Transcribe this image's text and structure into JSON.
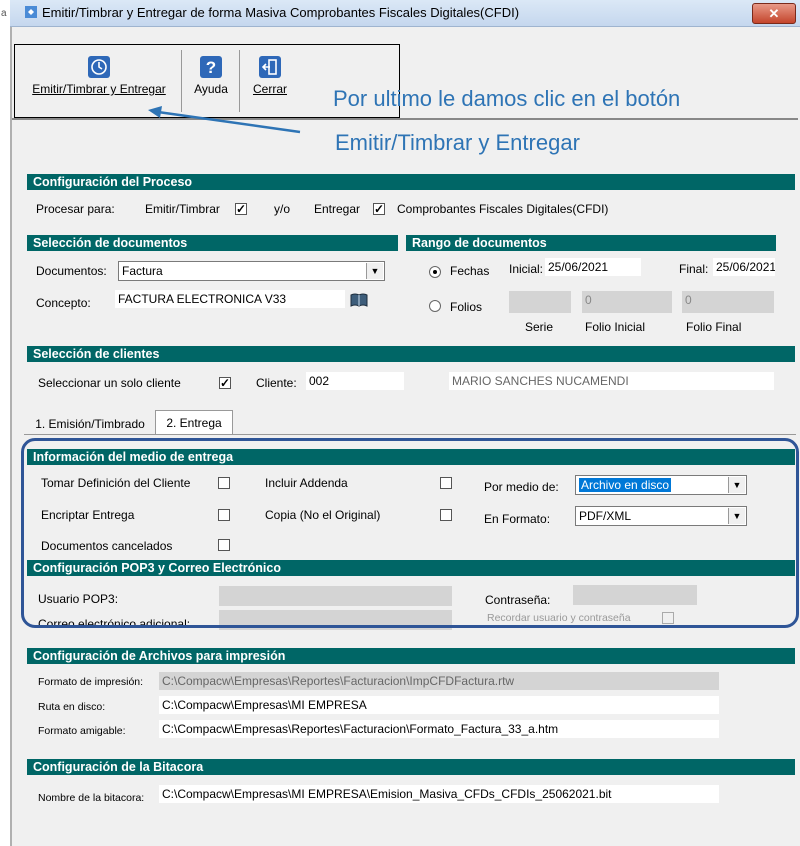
{
  "window": {
    "title": "Emitir/Timbrar y Entregar de forma Masiva Comprobantes Fiscales Digitales(CFDI)",
    "close_label": "✕",
    "side_char": "a"
  },
  "toolbar": {
    "emit_label": "Emitir/Timbrar y Entregar",
    "help_label": "Ayuda",
    "close_label": "Cerrar"
  },
  "callout": {
    "line1": "Por ultimo le damos clic en el botón",
    "line2": "Emitir/Timbrar y Entregar"
  },
  "proceso": {
    "header": "Configuración del Proceso",
    "procesar_para": "Procesar para:",
    "emitir_timbrar": "Emitir/Timbrar",
    "yo": "y/o",
    "entregar": "Entregar",
    "cfdi": "Comprobantes Fiscales Digitales(CFDI)",
    "emitir_checked": "✓",
    "entregar_checked": "✓"
  },
  "documentos": {
    "header": "Selección de documentos",
    "documentos_label": "Documentos:",
    "documentos_value": "Factura",
    "concepto_label": "Concepto:",
    "concepto_value": "FACTURA ELECTRONICA V33"
  },
  "rango": {
    "header": "Rango de documentos",
    "fechas_label": "Fechas",
    "inicial_label": "Inicial:",
    "inicial_value": "25/06/2021",
    "final_label": "Final:",
    "final_value": "25/06/2021",
    "folios_label": "Folios",
    "folio_inicial_value": "0",
    "folio_final_value": "0",
    "serie_label": "Serie",
    "folio_inicial_label": "Folio Inicial",
    "folio_final_label": "Folio Final"
  },
  "clientes": {
    "header": "Selección de clientes",
    "solo_cliente_label": "Seleccionar un solo cliente",
    "solo_cliente_checked": "✓",
    "cliente_label": "Cliente:",
    "cliente_code": "002",
    "cliente_name": "MARIO SANCHES NUCAMENDI"
  },
  "tabs": [
    {
      "label": "1. Emisión/Timbrado"
    },
    {
      "label": "2. Entrega"
    }
  ],
  "entrega": {
    "header": "Información del medio de entrega",
    "tomar_def": "Tomar Definición del Cliente",
    "incluir_addenda": "Incluir Addenda",
    "por_medio_label": "Por medio de:",
    "por_medio_value": "Archivo en disco",
    "encriptar": "Encriptar Entrega",
    "copia": "Copia (No el Original)",
    "en_formato_label": "En Formato:",
    "en_formato_value": "PDF/XML",
    "docs_cancelados": "Documentos cancelados"
  },
  "pop3": {
    "header": "Configuración POP3 y Correo Electrónico",
    "usuario_label": "Usuario POP3:",
    "correo_label": "Correo electrónico adicional:",
    "contrasena_label": "Contraseña:",
    "recordar_label": "Recordar usuario y contraseña"
  },
  "archivos": {
    "header": "Configuración de Archivos para impresión",
    "formato_label": "Formato de impresión:",
    "formato_value": "C:\\Compacw\\Empresas\\Reportes\\Facturacion\\ImpCFDFactura.rtw",
    "ruta_label": "Ruta en disco:",
    "ruta_value": "C:\\Compacw\\Empresas\\MI EMPRESA",
    "amigable_label": "Formato amigable:",
    "amigable_value": "C:\\Compacw\\Empresas\\Reportes\\Facturacion\\Formato_Factura_33_a.htm"
  },
  "bitacora": {
    "header": "Configuración de la Bitacora",
    "nombre_label": "Nombre de la bitacora:",
    "nombre_value": "C:\\Compacw\\Empresas\\MI EMPRESA\\Emision_Masiva_CFDs_CFDIs_25062021.bit"
  },
  "colors": {
    "section_bar": "#006666",
    "callout": "#2e74b5",
    "highlight_border": "#2f5597",
    "selected": "#0078d7"
  }
}
